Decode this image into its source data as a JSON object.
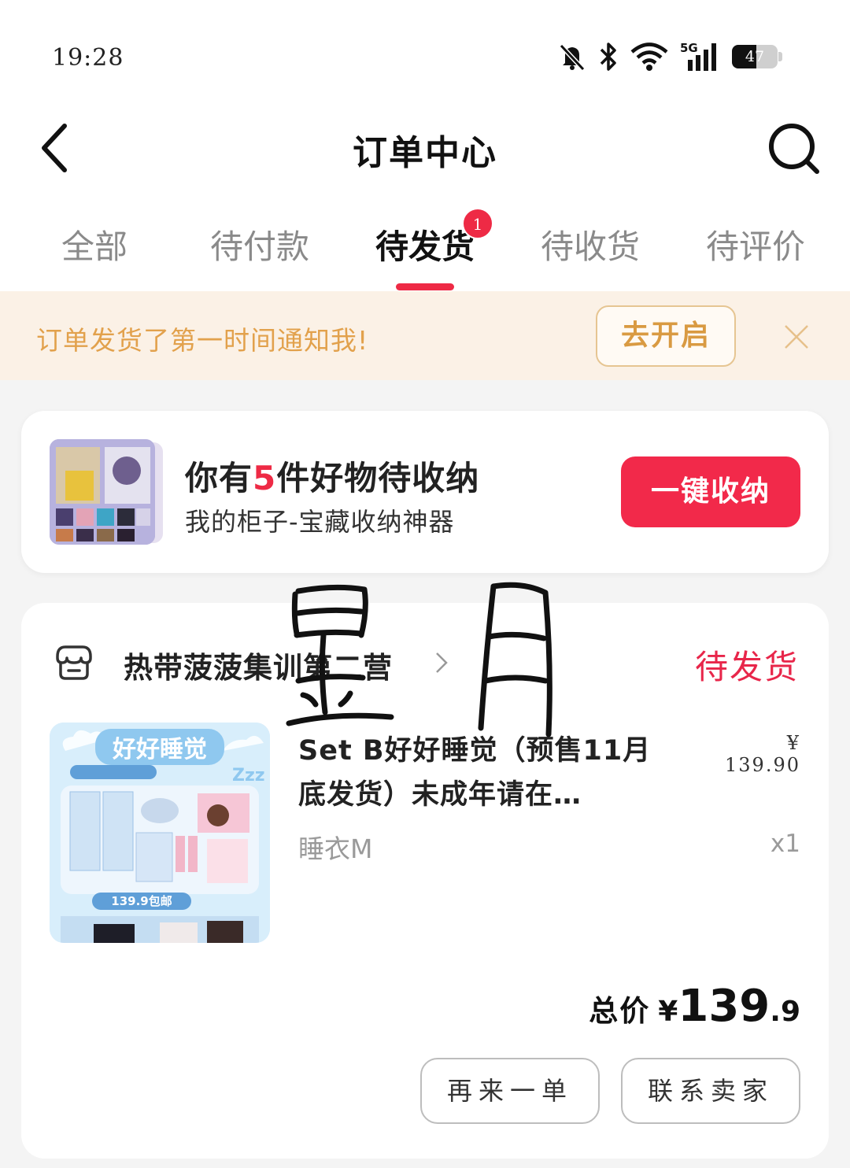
{
  "status_bar": {
    "time": "19:28",
    "battery_level": "47",
    "network": "5G"
  },
  "header": {
    "title": "订单中心"
  },
  "tabs": [
    {
      "label": "全部"
    },
    {
      "label": "待付款"
    },
    {
      "label": "待发货",
      "active": true,
      "badge": "1"
    },
    {
      "label": "待收货"
    },
    {
      "label": "待评价"
    }
  ],
  "notice": {
    "text": "订单发货了第一时间通知我!",
    "button": "去开启"
  },
  "promo": {
    "title_before": "你有",
    "title_count": "5",
    "title_after": "件好物待收纳",
    "subtitle": "我的柜子-宝藏收纳神器",
    "button": "一键收纳"
  },
  "order": {
    "shop_name": "热带菠菠集训第二营",
    "status": "待发货",
    "product": {
      "title": "Set B好好睡觉（预售11月底发货）未成年请在…",
      "price": "¥ 139.90",
      "spec": "睡衣M",
      "qty": "x1"
    },
    "total": {
      "label": "总价",
      "currency": "¥",
      "integer": "139",
      "decimal": ".9"
    },
    "actions": {
      "rebuy": "再来一单",
      "contact": "联系卖家"
    }
  },
  "colors": {
    "accent": "#ee2a45",
    "notice_text": "#e2a14c",
    "background": "#f4f4f4"
  }
}
